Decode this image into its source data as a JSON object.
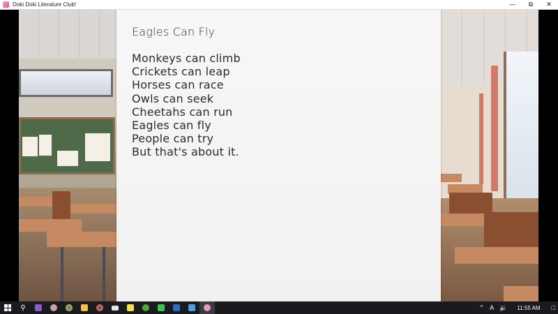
{
  "window": {
    "title": "Doki Doki Literature Club!",
    "minimize_icon": "minimize-icon",
    "restore_icon": "restore-icon",
    "close_icon": "close-icon"
  },
  "poem": {
    "title": "Eagles Can Fly",
    "lines": [
      "Monkeys can climb",
      "Crickets can leap",
      "Horses can race",
      "Owls can seek",
      "Cheetahs can run",
      "Eagles can fly",
      "People can try",
      "But that's about it."
    ]
  },
  "taskbar": {
    "apps": [
      {
        "name": "start-icon",
        "color": "#ffffff"
      },
      {
        "name": "search-icon",
        "color": "#ffffff"
      },
      {
        "name": "visual-studio-icon",
        "color": "#8a5cc9"
      },
      {
        "name": "app-icon-owl",
        "color": "#c9a4a4"
      },
      {
        "name": "chrome-icon",
        "color": "#3f9c4e"
      },
      {
        "name": "file-explorer-icon",
        "color": "#f2c04a"
      },
      {
        "name": "firefox-icon",
        "color": "#e66a2c"
      },
      {
        "name": "mail-icon",
        "color": "#e8e8e8"
      },
      {
        "name": "sticky-notes-icon",
        "color": "#f2e24a"
      },
      {
        "name": "xbox-icon",
        "color": "#4caa3a"
      },
      {
        "name": "line-icon",
        "color": "#3fbf4f"
      },
      {
        "name": "word-icon",
        "color": "#2f6bc1"
      },
      {
        "name": "media-icon",
        "color": "#4a9fe0"
      },
      {
        "name": "ddlc-icon",
        "color": "#e39bc3"
      }
    ],
    "tray": {
      "chevron_icon": "chevron-up-icon",
      "ime_label": "A",
      "volume_icon": "volume-icon",
      "time": "11:55 AM",
      "notification_icon": "notification-icon"
    }
  }
}
